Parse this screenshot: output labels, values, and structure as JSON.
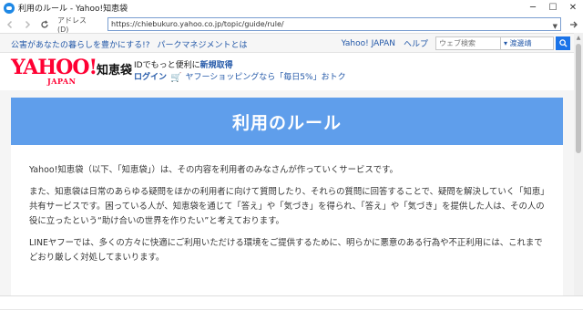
{
  "window": {
    "title": "利用のルール - Yahoo!知恵袋"
  },
  "address_bar": {
    "label": "アドレス(D)",
    "url": "https://chiebukuro.yahoo.co.jp/topic/guide/rule/"
  },
  "yahoo_header": {
    "links": [
      "公害があなたの暮らしを豊かにする!?",
      "パークマネジメントとは"
    ],
    "yahoo_japan": "Yahoo! JAPAN",
    "help": "ヘルプ",
    "search_placeholder": "ウェブ検索",
    "search_option": "▾ 渡邊靖"
  },
  "logo": {
    "yahoo": "YAHOO!",
    "japan": "JAPAN",
    "service": "知恵袋"
  },
  "promo": {
    "line1_prefix": "IDでもっと便利に",
    "new_registration": "新規取得",
    "login": "ログイン",
    "shopping": "ヤフーショッピングなら「毎日5%」おトク"
  },
  "page": {
    "title": "利用のルール",
    "paragraphs": [
      "Yahoo!知恵袋（以下、「知恵袋」）は、その内容を利用者のみなさんが作っていくサービスです。",
      "また、知恵袋は日常のあらゆる疑問をほかの利用者に向けて質問したり、それらの質問に回答することで、疑問を解決していく「知恵」共有サービスです。困っている人が、知恵袋を通じて「答え」や「気づき」を得られ、「答え」や「気づき」を提供した人は、その人の役に立ったという“助け合いの世界を作りたい”と考えております。",
      "LINEヤフーでは、多くの方々に快適にご利用いただける環境をご提供するために、明らかに悪意のある行為や不正利用には、これまでどおり厳しく対処してまいります。"
    ]
  },
  "colors": {
    "banner": "#5f9eeb",
    "link": "#2358a8",
    "yahoo_red": "#ff0033"
  }
}
